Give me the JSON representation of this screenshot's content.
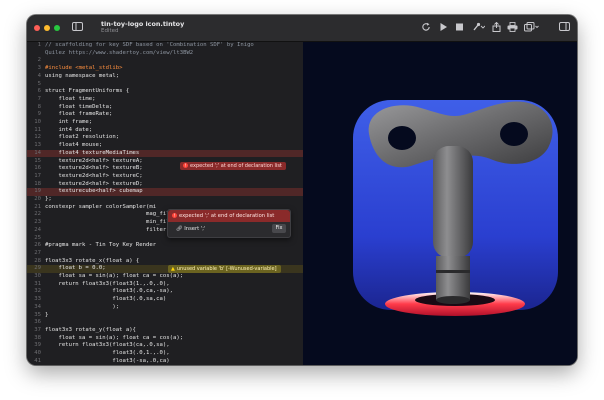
{
  "window": {
    "title": "tin-toy-logo icon.tintoy",
    "subtitle": "Edited"
  },
  "toolbar": {
    "sidebar_icon": "sidebar-icon",
    "refresh_icon": "refresh-icon",
    "play_icon": "play-icon",
    "stop_icon": "stop-icon",
    "brush_icon": "brush-icon",
    "export_icon": "export-icon",
    "print_icon": "printer-icon",
    "duplicate_icon": "duplicate-icon",
    "inspector_icon": "inspector-icon"
  },
  "editor": {
    "lines": [
      "// scaffolding for key SDF based on 'Combination SDF' by Inigo",
      "Quilez https://www.shadertoy.com/view/lt3BW2",
      "",
      "#include <metal_stdlib>",
      "using namespace metal;",
      "",
      "struct FragmentUniforms {",
      "    float time;",
      "    float timeDelta;",
      "    float frameRate;",
      "    int frame;",
      "    int4 date;",
      "    float2 resolution;",
      "    float4 mouse;",
      "    float4 textureMediaTimes",
      "    texture2d<half> textureA;",
      "    texture2d<half> textureB;",
      "    texture2d<half> textureC;",
      "    texture2d<half> textureD;",
      "    texturecube<half> cubemap",
      "};",
      "constexpr sampler colorSampler(mi",
      "                              mag_filter::linear,",
      "                              min_filter::linear,",
      "                              filter::linear);",
      "",
      "#pragma mark - Tin Toy Key Render",
      "",
      "float3x3 rotate_x(float a) {",
      "    float b = 0.0;",
      "    float sa = sin(a); float ca = cos(a);",
      "    return float3x3(float3(1.,.0,.0),",
      "                    float3(.0,ca,-sa),",
      "                    float3(.0,sa,ca)",
      "                    );",
      "}",
      "",
      "float3x3 rotate_y(float a){",
      "    float sa = sin(a); float ca = cos(a);",
      "    return float3x3(float3(ca,.0,sa),",
      "                    float3(.0,1.,.0),",
      "                    float3(-sa,.0,ca)"
    ],
    "error_badge": "expected ';' at end of declaration list",
    "warning_badge": "unused variable 'b' [-Wunused-variable]",
    "popup": {
      "message": "expected ';' at end of declaration list",
      "action": "Insert ';'",
      "fix_label": "Fix"
    }
  },
  "colors": {
    "editor_bg": "#1f1f22",
    "comment": "#8d95a0",
    "keyword": "#fc5fa3",
    "preprocessor": "#fd8f3f",
    "error": "#ff453a",
    "warning": "#ffd60a",
    "canvas_bg": "#050a1e"
  }
}
